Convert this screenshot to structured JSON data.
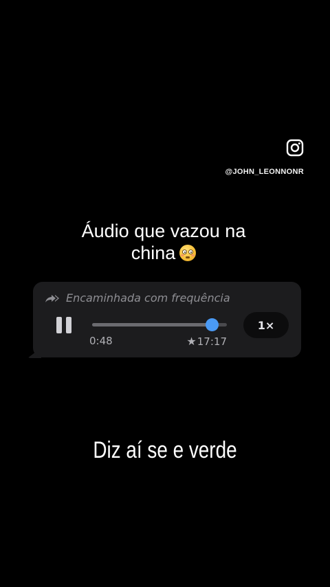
{
  "watermark": {
    "icon": "instagram-icon",
    "handle": "@JOHN_LEONNONR"
  },
  "headline": {
    "line1": "Áudio que vazou na",
    "line2": "china",
    "emoji": "flushed-face-emoji"
  },
  "audio_message": {
    "forwarded_label": "Encaminhada com frequência",
    "forward_icon": "double-forward-arrow-icon",
    "play_state": "pause-icon",
    "elapsed_time": "0:48",
    "total_time": "17:17",
    "total_prefix_icon": "star-icon",
    "speed_label": "1×",
    "progress": 0.89,
    "colors": {
      "bubble": "#1c1c1e",
      "knob": "#4a9af5",
      "secondary_text": "#8e8e93"
    }
  },
  "caption": "Diz aí se e verde"
}
